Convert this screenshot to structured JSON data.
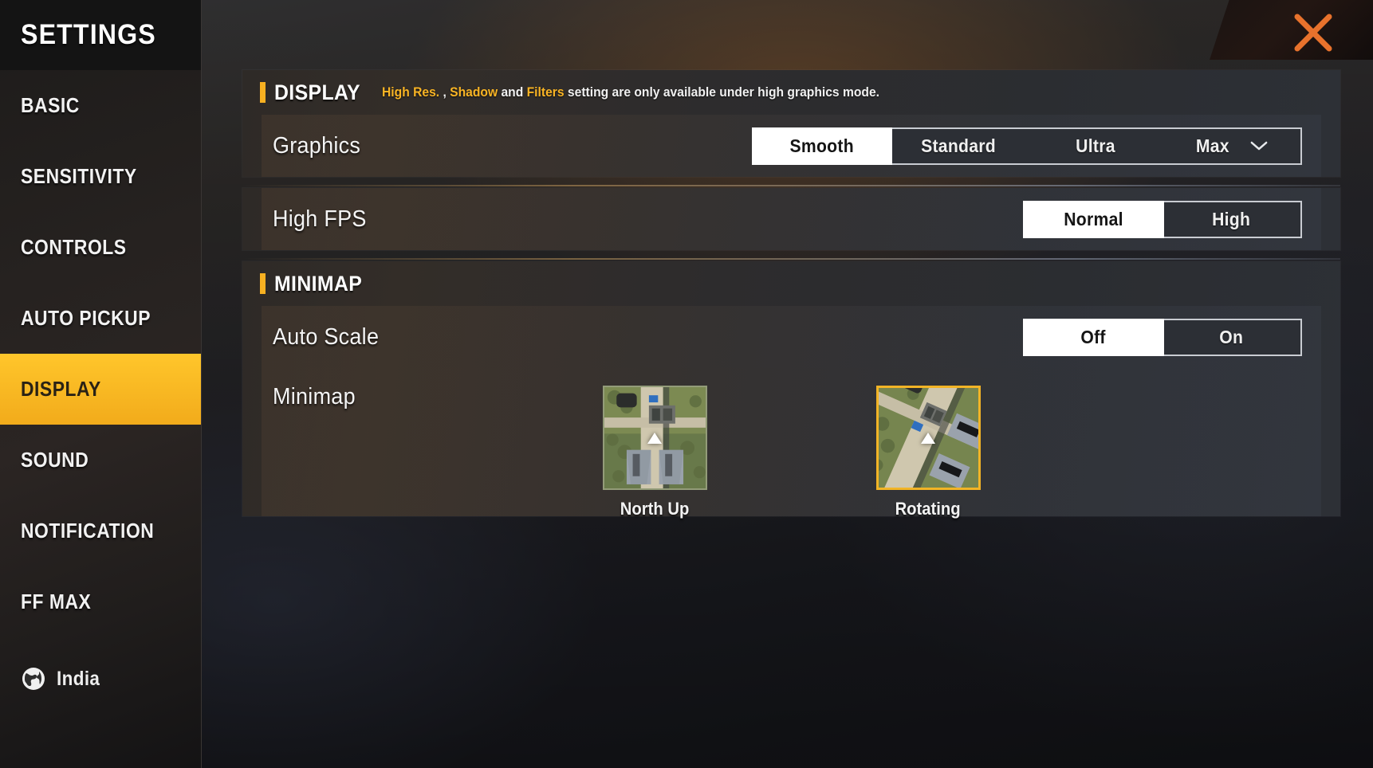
{
  "app": {
    "title": "SETTINGS"
  },
  "sidebar": {
    "items": [
      {
        "label": "BASIC",
        "active": false
      },
      {
        "label": "SENSITIVITY",
        "active": false
      },
      {
        "label": "CONTROLS",
        "active": false
      },
      {
        "label": "AUTO PICKUP",
        "active": false
      },
      {
        "label": "DISPLAY",
        "active": true
      },
      {
        "label": "SOUND",
        "active": false
      },
      {
        "label": "NOTIFICATION",
        "active": false
      },
      {
        "label": "FF MAX",
        "active": false
      }
    ],
    "locale": {
      "label": "India",
      "icon": "globe-icon"
    }
  },
  "close_button": {
    "icon": "close-icon",
    "color": "#e8722c"
  },
  "sections": {
    "display": {
      "title": "DISPLAY",
      "note_parts": [
        {
          "text": "High Res. ",
          "highlight": true
        },
        {
          "text": ", ",
          "highlight": false
        },
        {
          "text": "Shadow",
          "highlight": true
        },
        {
          "text": " and ",
          "highlight": false
        },
        {
          "text": "Filters",
          "highlight": true
        },
        {
          "text": " setting are only available under high graphics mode.",
          "highlight": false
        }
      ],
      "note_plain": "High Res. , Shadow and Filters setting are only available under high graphics mode.",
      "rows": [
        {
          "label": "Graphics",
          "control": "segmented",
          "options": [
            "Smooth",
            "Standard",
            "Ultra",
            "Max"
          ],
          "selected": "Smooth",
          "has_caret": true,
          "caret_icon": "chevron-down-icon"
        },
        {
          "label": "High FPS",
          "control": "toggle",
          "options": [
            "Normal",
            "High"
          ],
          "selected": "Normal"
        }
      ]
    },
    "minimap": {
      "title": "MINIMAP",
      "rows": [
        {
          "label": "Auto Scale",
          "control": "toggle",
          "options": [
            "Off",
            "On"
          ],
          "selected": "Off"
        },
        {
          "label": "Minimap",
          "control": "thumbnails",
          "thumbnails": [
            {
              "label": "North Up",
              "selected": false,
              "arrow": "up"
            },
            {
              "label": "Rotating",
              "selected": true,
              "arrow": "up"
            }
          ]
        }
      ]
    }
  },
  "colors": {
    "accent": "#f7b021",
    "selected_nav": "#ffc62b",
    "close_x": "#e8722c",
    "thumb_selected_border": "#f2b426"
  }
}
